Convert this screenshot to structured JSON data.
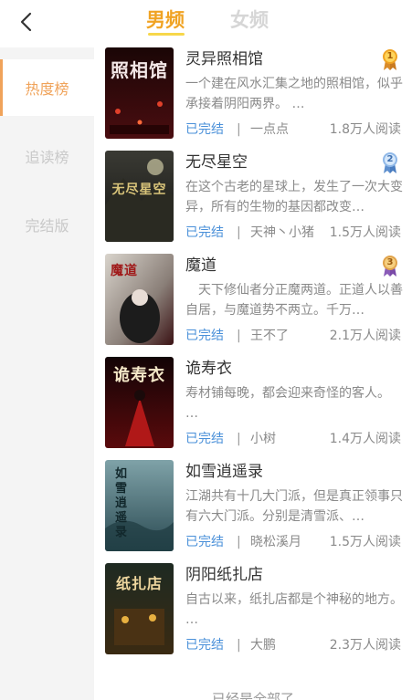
{
  "header": {
    "tab_male": "男频",
    "tab_female": "女频"
  },
  "sidebar": {
    "items": [
      {
        "label": "热度榜"
      },
      {
        "label": "追读榜"
      },
      {
        "label": "完结版"
      }
    ]
  },
  "books": [
    {
      "title": "灵异照相馆",
      "desc": "一个建在风水汇集之地的照相馆，似乎承接着阴阳两界。 …",
      "status": "已完结",
      "sep": "|",
      "author": "一点点",
      "reads": "1.8万人阅读",
      "cover_text": "照相馆",
      "rank": "1",
      "rank_color": "#f0a323"
    },
    {
      "title": "无尽星空",
      "desc": "在这个古老的星球上，发生了一次大变异，所有的生物的基因都改变…",
      "status": "已完结",
      "sep": "|",
      "author": "天神丶小猪",
      "reads": "1.5万人阅读",
      "cover_text": "无尽星空",
      "rank": "2",
      "rank_color": "#8fb8e8"
    },
    {
      "title": "魔道",
      "desc": "　天下修仙者分正魔两道。正道人以善自居，与魔道势不两立。千万…",
      "status": "已完结",
      "sep": "|",
      "author": "王不了",
      "reads": "2.1万人阅读",
      "cover_text": "魔道",
      "rank": "3",
      "rank_color": "#e0a24a"
    },
    {
      "title": "诡寿衣",
      "desc": "寿材铺每晚，都会迎来奇怪的客人。 …",
      "status": "已完结",
      "sep": "|",
      "author": "小树",
      "reads": "1.4万人阅读",
      "cover_text": "诡寿衣",
      "rank": "",
      "rank_color": ""
    },
    {
      "title": "如雪逍遥录",
      "desc": "江湖共有十几大门派，但是真正领事只有六大门派。分别是清雪派、…",
      "status": "已完结",
      "sep": "|",
      "author": "晓松溪月",
      "reads": "1.5万人阅读",
      "cover_text": "如雪逍遥录",
      "rank": "",
      "rank_color": ""
    },
    {
      "title": "阴阳纸扎店",
      "desc": "自古以来，纸扎店都是个神秘的地方。 …",
      "status": "已完结",
      "sep": "|",
      "author": "大鹏",
      "reads": "2.3万人阅读",
      "cover_text": "纸扎店",
      "rank": "",
      "rank_color": ""
    }
  ],
  "footer": {
    "text": "已经是全部了"
  },
  "colors": {
    "accent": "#f0a323",
    "sidebar_active": "#f0a35a",
    "status_blue": "#4a90d9"
  }
}
